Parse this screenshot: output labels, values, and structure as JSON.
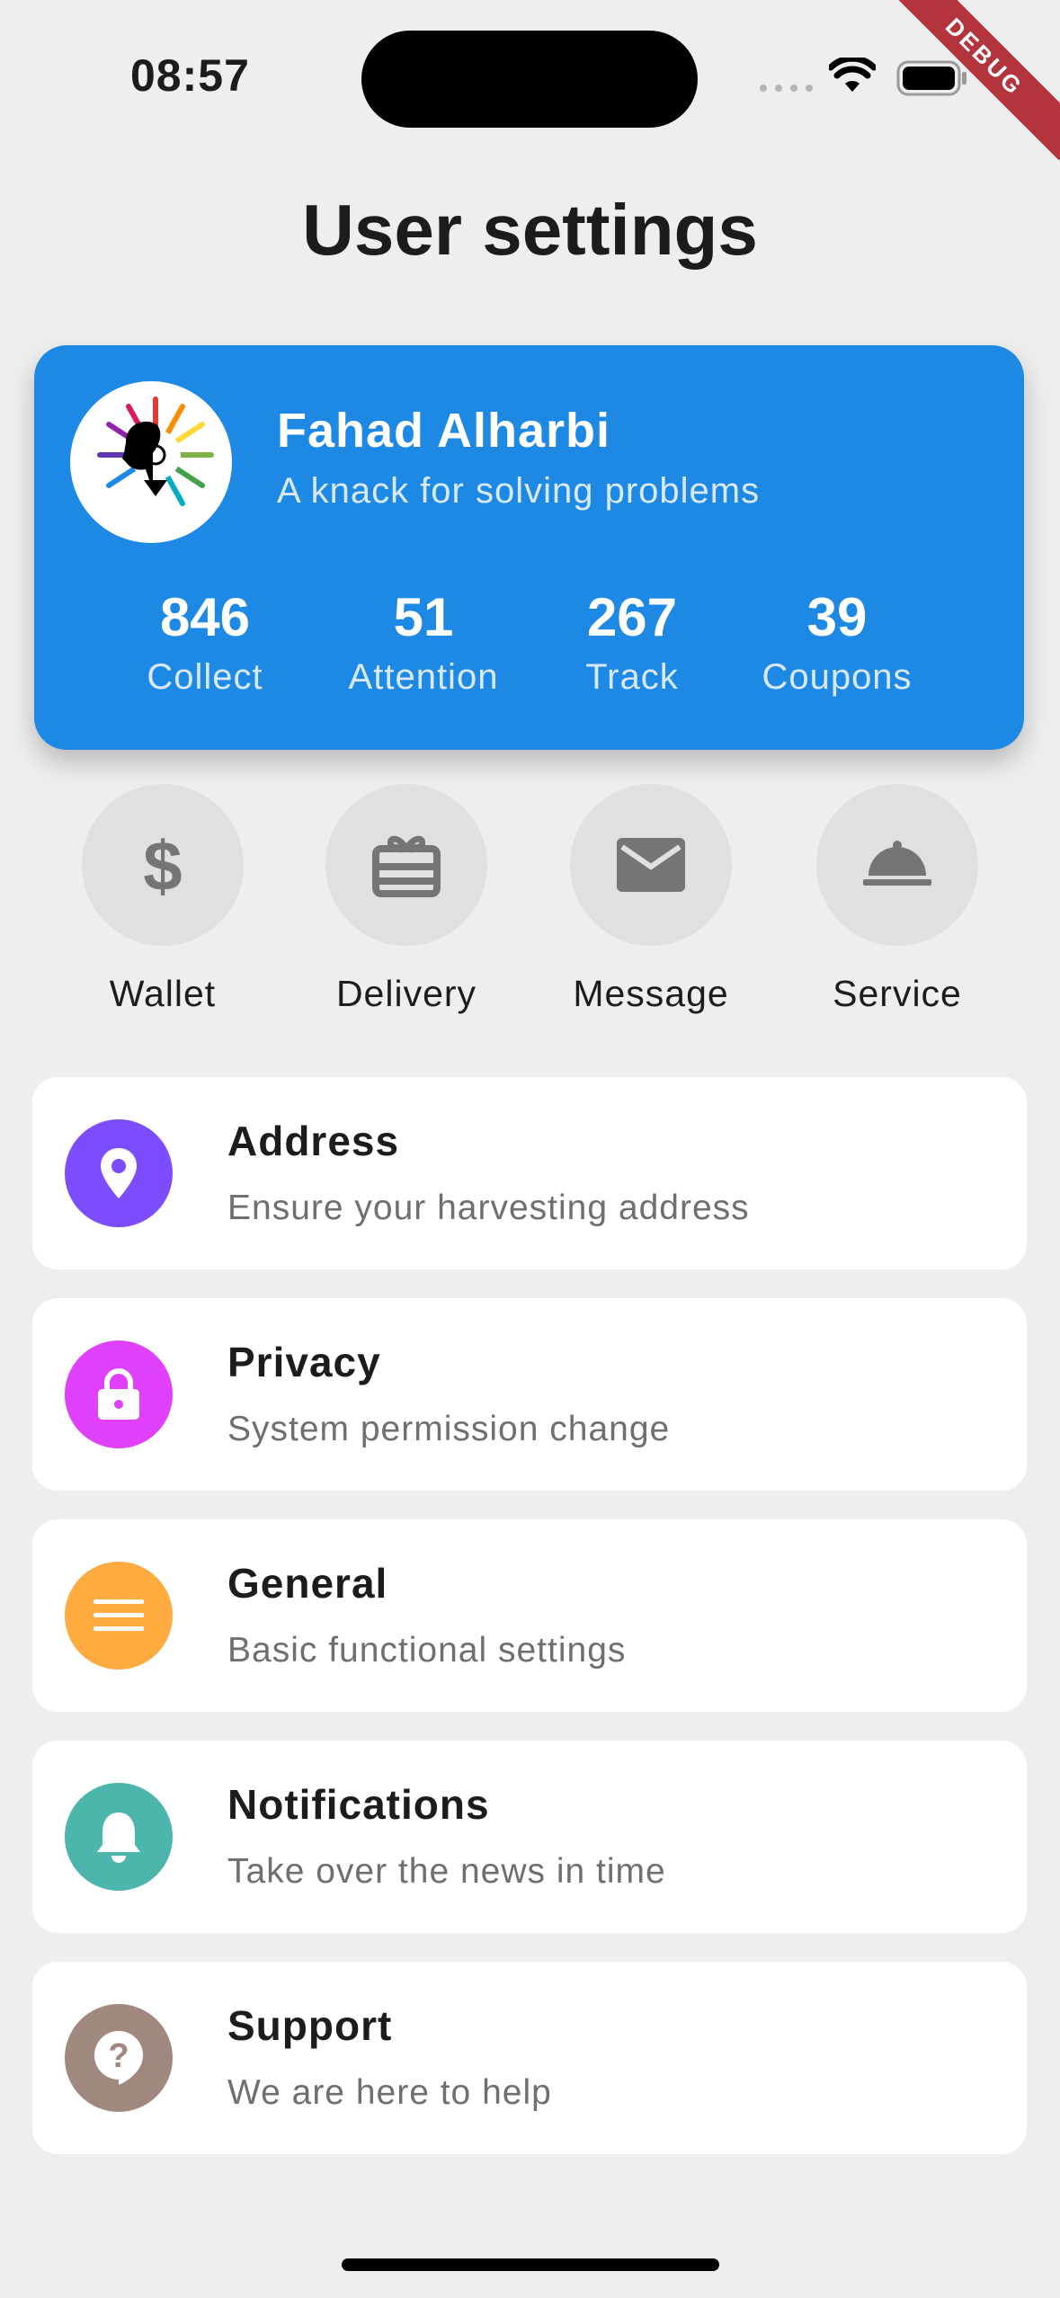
{
  "status_bar": {
    "time": "08:57"
  },
  "debug_label": "DEBUG",
  "page_title": "User settings",
  "profile": {
    "name": "Fahad Alharbi",
    "bio": "A knack for solving problems",
    "stats": [
      {
        "value": "846",
        "label": "Collect"
      },
      {
        "value": "51",
        "label": "Attention"
      },
      {
        "value": "267",
        "label": "Track"
      },
      {
        "value": "39",
        "label": "Coupons"
      }
    ],
    "card_color": "#1e88e5"
  },
  "quick_actions": [
    {
      "label": "Wallet",
      "icon": "dollar-icon"
    },
    {
      "label": "Delivery",
      "icon": "gift-card-icon"
    },
    {
      "label": "Message",
      "icon": "mail-icon"
    },
    {
      "label": "Service",
      "icon": "room-service-icon"
    }
  ],
  "settings": [
    {
      "title": "Address",
      "subtitle": "Ensure your harvesting address",
      "icon": "location-pin-icon",
      "color": "#7c4dff"
    },
    {
      "title": "Privacy",
      "subtitle": "System permission change",
      "icon": "lock-icon",
      "color": "#e040fb"
    },
    {
      "title": "General",
      "subtitle": "Basic functional settings",
      "icon": "menu-icon",
      "color": "#ffab40"
    },
    {
      "title": "Notifications",
      "subtitle": "Take over the news in time",
      "icon": "bell-icon",
      "color": "#4db6ac"
    },
    {
      "title": "Support",
      "subtitle": "We are here to help",
      "icon": "help-icon",
      "color": "#a1887f"
    }
  ]
}
